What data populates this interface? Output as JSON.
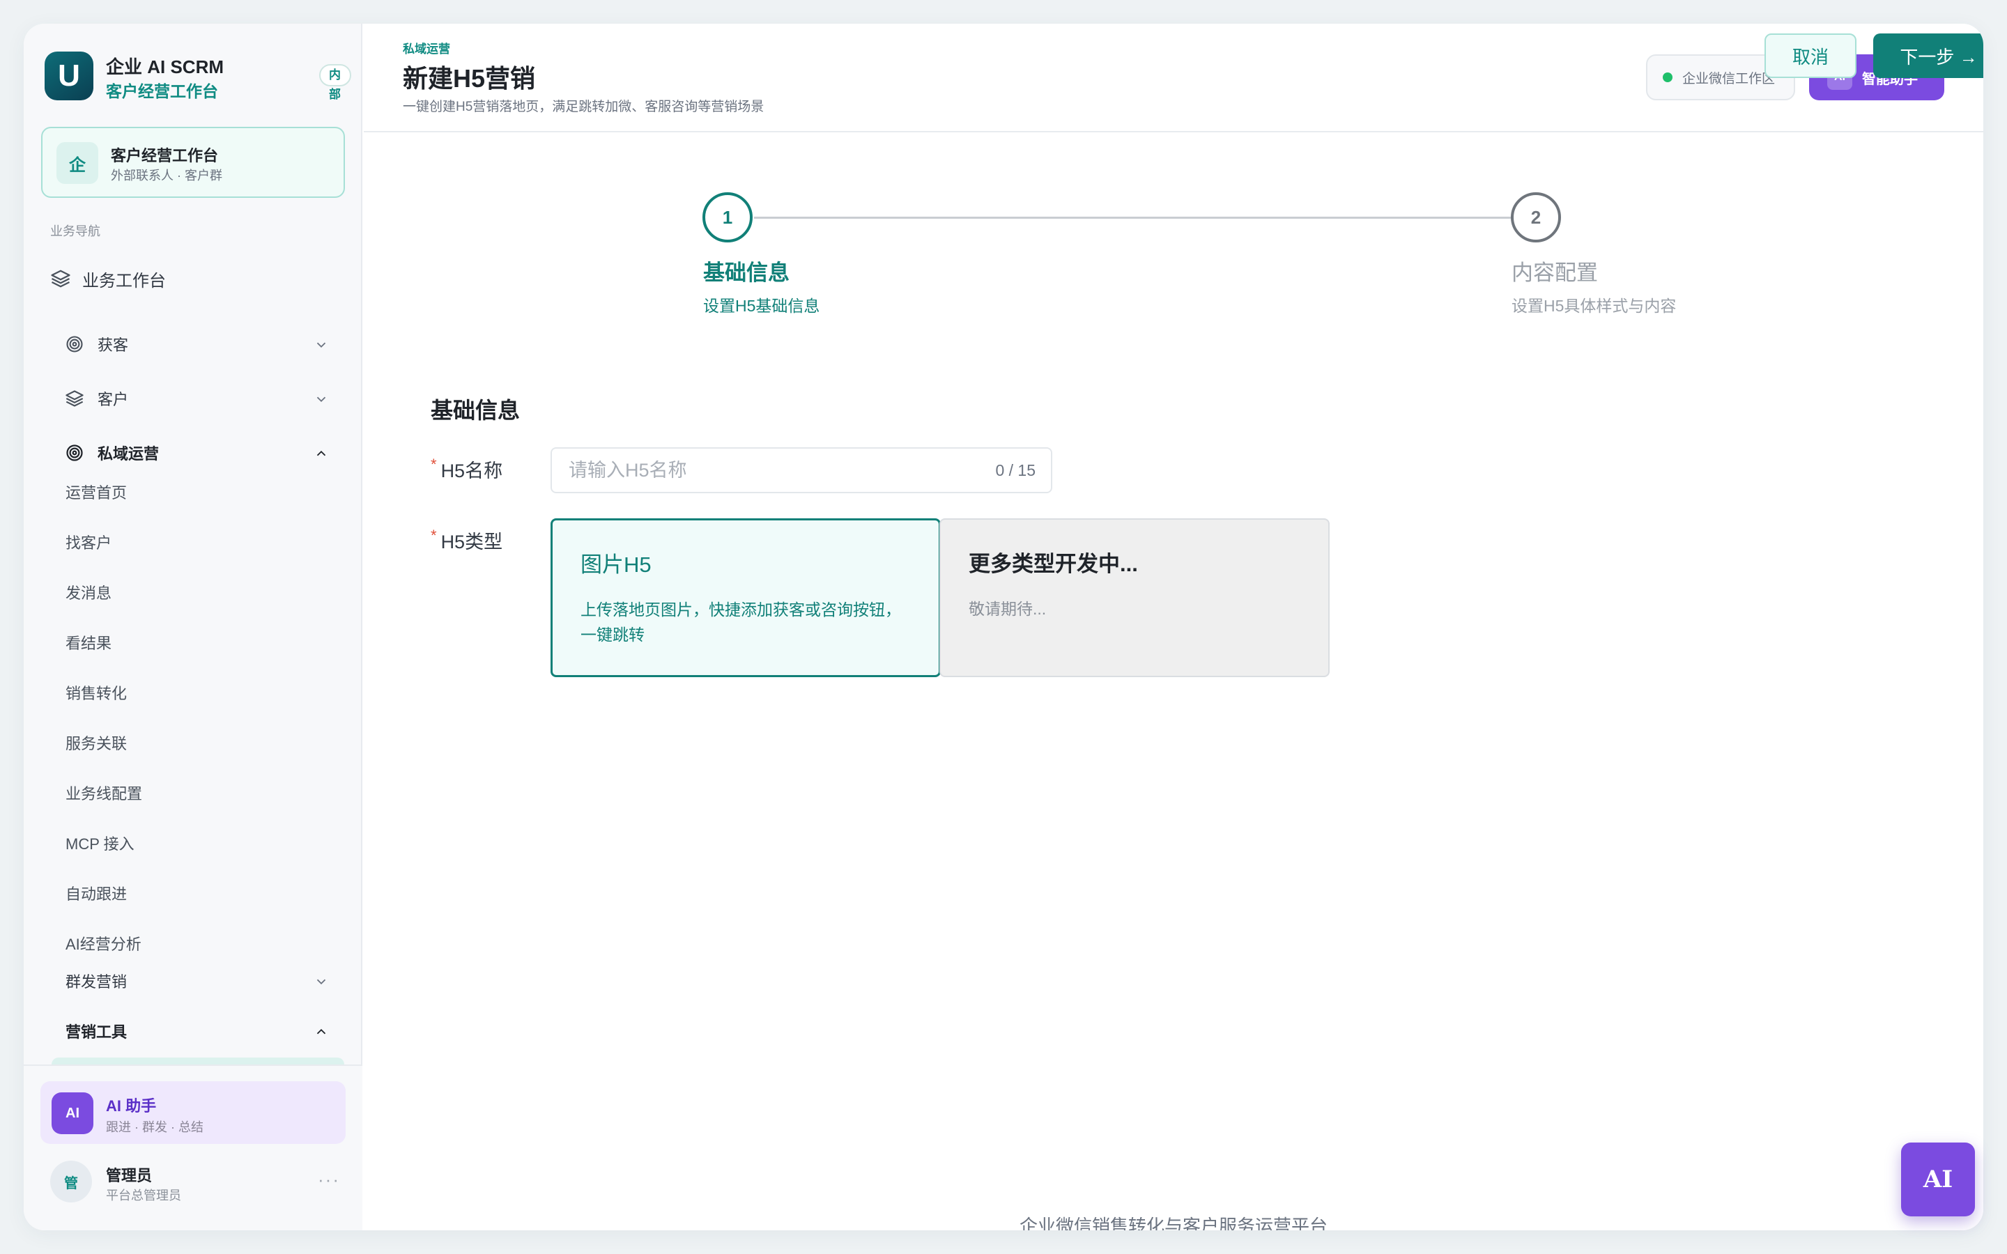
{
  "brand": {
    "name": "企业 AI SCRM",
    "subtitle": "客户经营工作台",
    "badge": "内部",
    "logo_letter": "U"
  },
  "workspace_card": {
    "icon_text": "企",
    "title": "客户经营工作台",
    "subtitle": "外部联系人 · 客户群"
  },
  "sidebar": {
    "section_label": "业务导航",
    "top_item": "业务工作台",
    "groups": [
      {
        "label": "获客",
        "expanded": false,
        "icon": "target-icon"
      },
      {
        "label": "客户",
        "expanded": false,
        "icon": "layers-icon"
      },
      {
        "label": "私域运营",
        "expanded": true,
        "icon": "target-icon"
      }
    ],
    "private_items": [
      "运营首页",
      "找客户",
      "发消息",
      "看结果",
      "销售转化",
      "服务关联",
      "业务线配置",
      "MCP 接入",
      "自动跟进",
      "AI经营分析"
    ],
    "group_mass": {
      "label": "群发营销",
      "expanded": false
    },
    "group_tools": {
      "label": "营销工具",
      "expanded": true
    }
  },
  "ai_assistant": {
    "icon_text": "AI",
    "title": "AI 助手",
    "subtitle": "跟进 · 群发 · 总结"
  },
  "user": {
    "avatar_text": "管",
    "name": "管理员",
    "role": "平台总管理员",
    "more": "···"
  },
  "header": {
    "breadcrumb": "私域运营",
    "title": "新建H5营销",
    "description": "一键创建H5营销落地页，满足跳转加微、客服咨询等营销场景",
    "ws_status": "企业微信工作区",
    "ai_button_icon": "AI",
    "ai_button": "智能助手",
    "cancel": "取消",
    "next": "下一步 →"
  },
  "steps": [
    {
      "number": "1",
      "title": "基础信息",
      "subtitle": "设置H5基础信息",
      "active": true
    },
    {
      "number": "2",
      "title": "内容配置",
      "subtitle": "设置H5具体样式与内容",
      "active": false
    }
  ],
  "form": {
    "section_title": "基础信息",
    "name_label": "H5名称",
    "name_placeholder": "请输入H5名称",
    "name_value": "",
    "name_counter": "0 / 15",
    "type_label": "H5类型",
    "required_mark": "*",
    "types": [
      {
        "title": "图片H5",
        "desc": "上传落地页图片，快捷添加获客或咨询按钮，一键跳转",
        "selected": true
      },
      {
        "title": "更多类型开发中...",
        "desc": "敬请期待...",
        "selected": false
      }
    ]
  },
  "footer": {
    "text": "企业微信销售转化与客户服务运营平台"
  },
  "fab": {
    "label": "AI"
  },
  "colors": {
    "accent": "#118078",
    "ai_purple": "#7b4be0",
    "required": "#e0503a"
  }
}
